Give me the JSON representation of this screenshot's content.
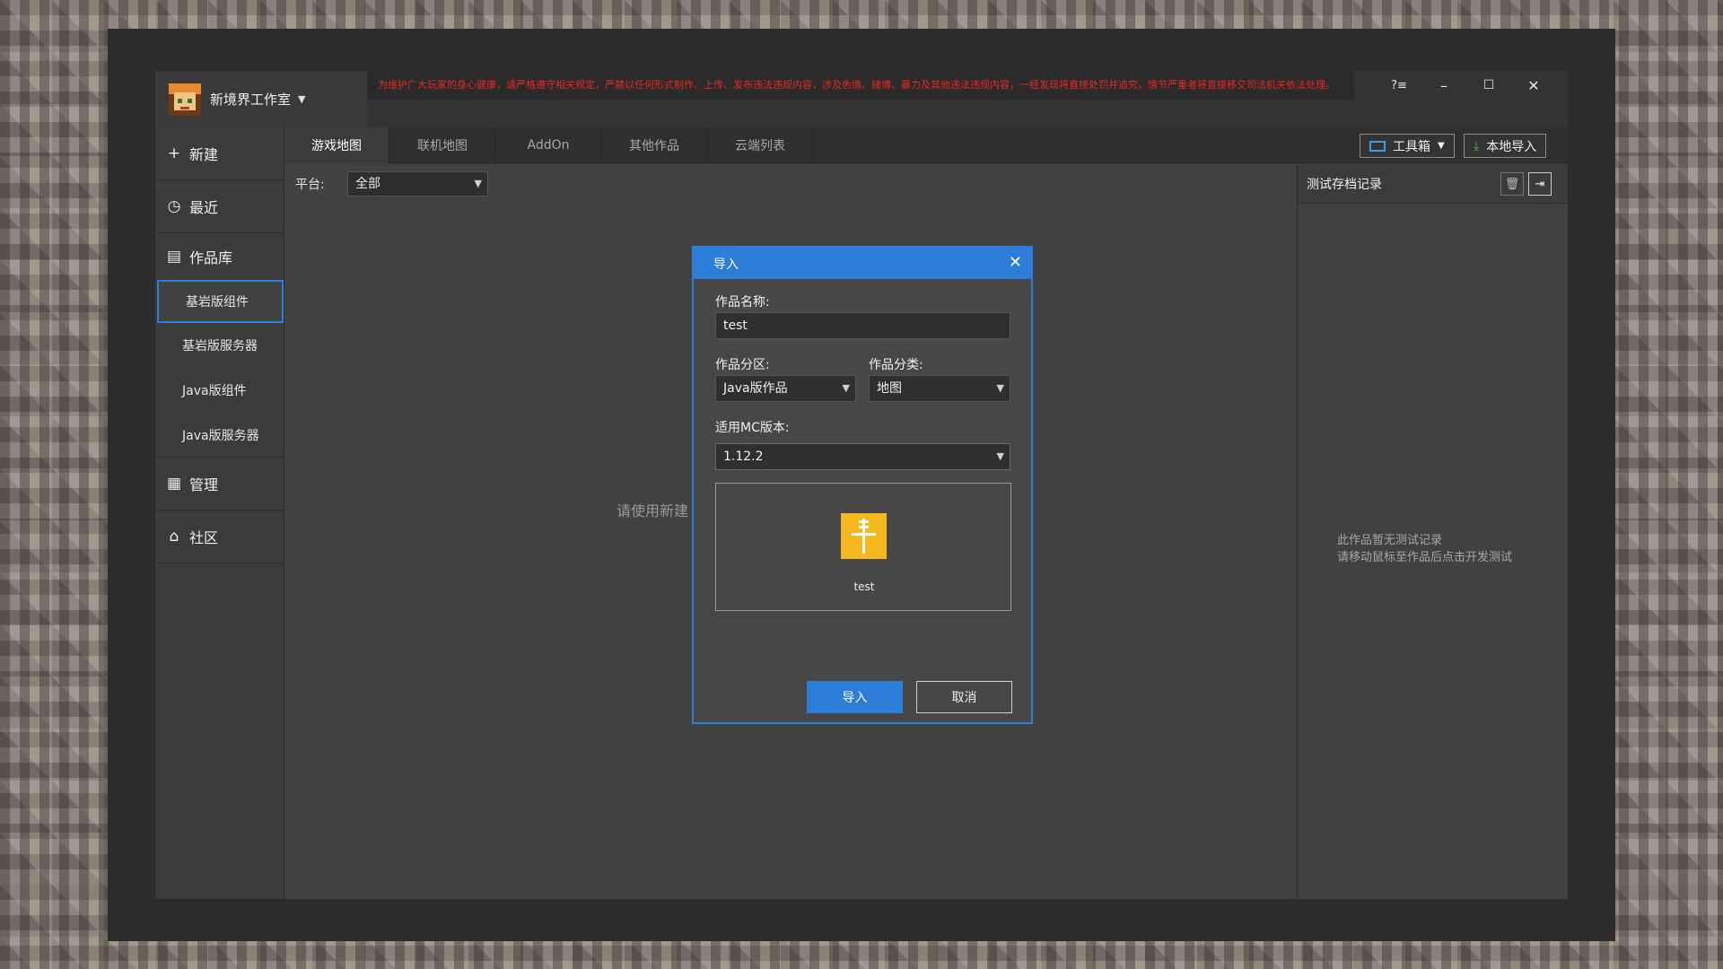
{
  "titlebar": {
    "studio_name": "新境界工作室",
    "notice": "为维护广大玩家的身心健康，请严格遵守相关规定，严禁以任何形式制作、上传、发布违法违规内容，涉及色情、赌博、暴力及其他违法违规内容，一经发现将直接处罚并追究，情节严重者将直接移交司法机关依法处理。",
    "help": "?≡",
    "minimize": "–",
    "maximize": "☐",
    "close": "✕"
  },
  "sidebar": {
    "new": "新建",
    "recent": "最近",
    "library": "作品库",
    "sub_items": [
      "基岩版组件",
      "基岩版服务器",
      "Java版组件",
      "Java版服务器"
    ],
    "manage": "管理",
    "community": "社区"
  },
  "tabs": [
    "游戏地图",
    "联机地图",
    "AddOn",
    "其他作品",
    "云端列表"
  ],
  "toolbar": {
    "toolbox": "工具箱",
    "local_import": "本地导入"
  },
  "filter": {
    "platform_label": "平台:",
    "platform_value": "全部"
  },
  "main": {
    "empty_hint": "请使用新建"
  },
  "right_panel": {
    "title": "测试存档记录",
    "empty_line1": "此作品暂无测试记录",
    "empty_line2": "请移动鼠标至作品后点击开发测试"
  },
  "dialog": {
    "title": "导入",
    "close": "✕",
    "name_label": "作品名称:",
    "name_value": "test",
    "section_label": "作品分区:",
    "section_value": "Java版作品",
    "category_label": "作品分类:",
    "category_value": "地图",
    "version_label": "适用MC版本:",
    "version_value": "1.12.2",
    "preview_name": "test",
    "import_button": "导入",
    "cancel_button": "取消"
  },
  "colors": {
    "accent": "#2d7ed8",
    "notice": "#e8291f",
    "preview_icon": "#f5b81e"
  }
}
